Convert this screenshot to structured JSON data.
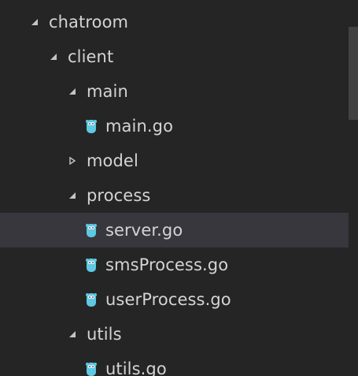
{
  "explorer": {
    "items": [
      {
        "label": "chatroom",
        "kind": "folder",
        "expanded": true
      },
      {
        "label": "client",
        "kind": "folder",
        "expanded": true
      },
      {
        "label": "main",
        "kind": "folder",
        "expanded": true
      },
      {
        "label": "main.go",
        "kind": "file",
        "icon": "go-gopher-icon"
      },
      {
        "label": "model",
        "kind": "folder",
        "expanded": false
      },
      {
        "label": "process",
        "kind": "folder",
        "expanded": true
      },
      {
        "label": "server.go",
        "kind": "file",
        "icon": "go-gopher-icon",
        "selected": true
      },
      {
        "label": "smsProcess.go",
        "kind": "file",
        "icon": "go-gopher-icon"
      },
      {
        "label": "userProcess.go",
        "kind": "file",
        "icon": "go-gopher-icon"
      },
      {
        "label": "utils",
        "kind": "folder",
        "expanded": true
      },
      {
        "label": "utils.go",
        "kind": "file",
        "icon": "go-gopher-icon"
      }
    ]
  },
  "colors": {
    "background": "#252526",
    "selection": "#37373d",
    "text": "#d4d4d4",
    "go_icon": "#5dc9e2",
    "twistie": "#c5c5c5",
    "scrollbar_thumb": "#424242"
  }
}
